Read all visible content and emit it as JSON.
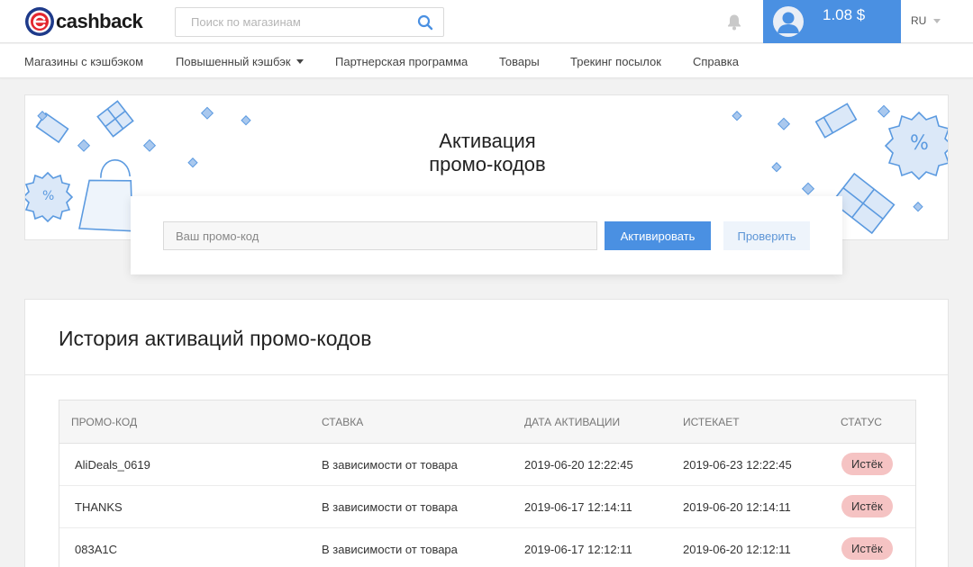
{
  "header": {
    "logo_text": "cashback",
    "search_placeholder": "Поиск по магазинам",
    "balance": "1.08 $",
    "language": "RU"
  },
  "nav": {
    "items": [
      "Магазины с кэшбэком",
      "Повышенный кэшбэк",
      "Партнерская программа",
      "Товары",
      "Трекинг посылок",
      "Справка"
    ]
  },
  "promo": {
    "title_line1": "Активация",
    "title_line2": "промо-кодов",
    "input_placeholder": "Ваш промо-код",
    "activate_label": "Активировать",
    "check_label": "Проверить"
  },
  "history": {
    "title": "История активаций промо-кодов",
    "columns": [
      "Промо-код",
      "Ставка",
      "Дата активации",
      "Истекает",
      "Статус"
    ],
    "rows": [
      {
        "code": "AliDeals_0619",
        "rate": "В зависимости от товара",
        "activated": "2019-06-20 12:22:45",
        "expires": "2019-06-23 12:22:45",
        "status": "Истёк"
      },
      {
        "code": "THANKS",
        "rate": "В зависимости от товара",
        "activated": "2019-06-17 12:14:11",
        "expires": "2019-06-20 12:14:11",
        "status": "Истёк"
      },
      {
        "code": "083A1C",
        "rate": "В зависимости от товара",
        "activated": "2019-06-17 12:12:11",
        "expires": "2019-06-20 12:12:11",
        "status": "Истёк"
      }
    ]
  },
  "colors": {
    "accent": "#4a90e2",
    "logo_red": "#e3262e",
    "logo_blue": "#1e3a8a",
    "status_expired_bg": "#f5c3c3"
  }
}
